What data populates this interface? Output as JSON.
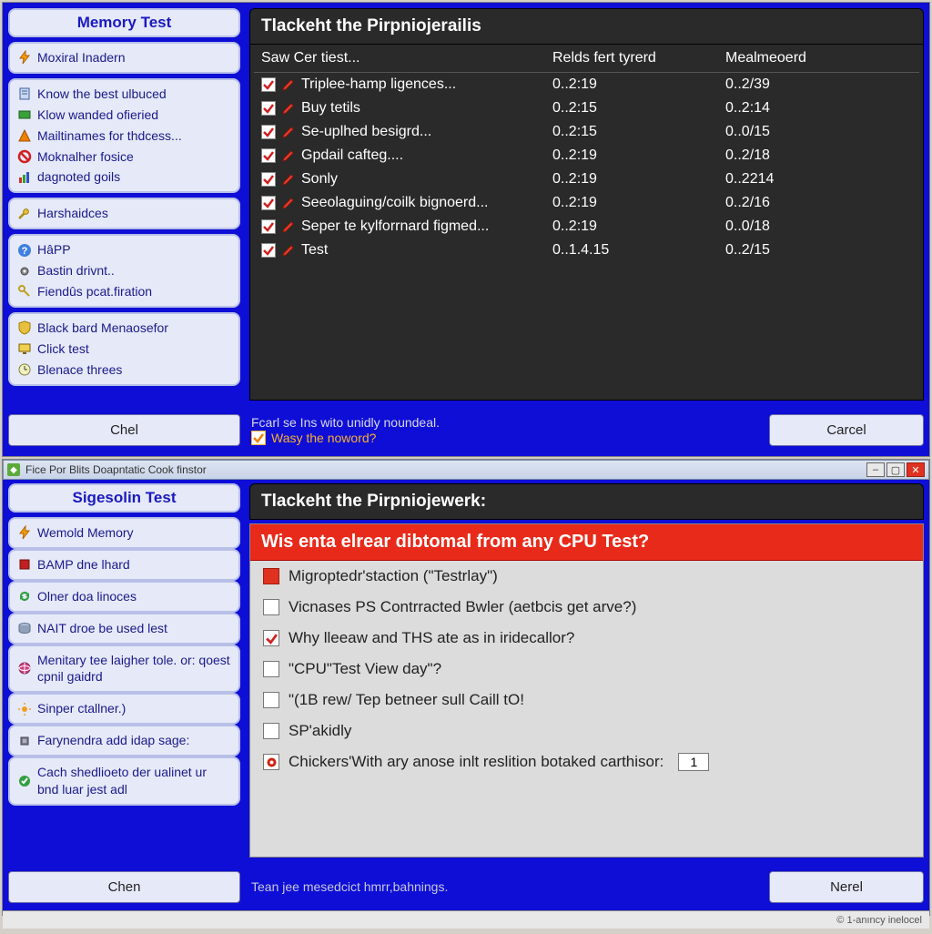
{
  "top": {
    "sidebar_title": "Memory Test",
    "group1": [
      {
        "icon": "bolt",
        "label": "Moxiral Inadern"
      }
    ],
    "group2": [
      {
        "icon": "doc",
        "label": "Know the best ulbuced"
      },
      {
        "icon": "green",
        "label": "Klow wanded ofieried"
      },
      {
        "icon": "orange",
        "label": "Mailtinames for thdcess..."
      },
      {
        "icon": "ored",
        "label": "Moknalher fosice"
      },
      {
        "icon": "chart",
        "label": "dagnoted goils"
      }
    ],
    "group3": [
      {
        "icon": "wrench",
        "label": "Harshaidces"
      }
    ],
    "group4": [
      {
        "icon": "help",
        "label": "HâPP"
      },
      {
        "icon": "gear",
        "label": "Bastin drivnt.."
      },
      {
        "icon": "key",
        "label": "Fiendûs pcat.firation"
      }
    ],
    "group5": [
      {
        "icon": "shield",
        "label": "Black bard Menaosefor"
      },
      {
        "icon": "monitor",
        "label": "Click test"
      },
      {
        "icon": "clock",
        "label": "Blenace threes"
      }
    ],
    "main_title": "Tlackeht the Pirpniojerailis",
    "cols": [
      "Saw Cer tiest...",
      "Relds fert tyrerd",
      "Mealmeoerd"
    ],
    "rows": [
      {
        "name": "Triplee-hamp ligences...",
        "a": "0..2:19",
        "b": "0..2/39"
      },
      {
        "name": "Buy tetils",
        "a": "0..2:15",
        "b": "0..2:14"
      },
      {
        "name": "Se-uplhed besigrd...",
        "a": "0..2:15",
        "b": "0..0/15"
      },
      {
        "name": "Gpdail cafteg....",
        "a": "0..2:19",
        "b": "0..2/18"
      },
      {
        "name": "Sonly",
        "a": "0..2:19",
        "b": "0..2214"
      },
      {
        "name": "Seeolaguing/coilk bignoerd...",
        "a": "0..2:19",
        "b": "0..2/16"
      },
      {
        "name": "Seper te kylforrnard figmed...",
        "a": "0..2:19",
        "b": "0..0/18"
      },
      {
        "name": "Test",
        "a": "0..1.4.15",
        "b": "0..2/15"
      }
    ],
    "footer_msg": "Fcarl se Ins wito unidly noundeal.",
    "footer_chk": "Wasy the noword?",
    "btn_left": "Chel",
    "btn_right": "Carcel"
  },
  "bot": {
    "titlebar": "Fice Por Blits Doapntatic Cook finstor",
    "sidebar_title": "Sigesolin Test",
    "items": [
      {
        "icon": "bolt",
        "label": "Wemold Memory"
      },
      {
        "icon": "stop",
        "label": "BAMP dne lhard"
      },
      {
        "icon": "refresh",
        "label": "Olner doa linoces"
      },
      {
        "icon": "disk",
        "label": "NAIT droe be used lest"
      },
      {
        "icon": "globe",
        "label": "Menitary tee laigher tole. or: qoest cpnil gaidrd"
      },
      {
        "icon": "sun",
        "label": "Sinper ctallner.)"
      },
      {
        "icon": "chip",
        "label": "Farynendra add idap sage:"
      },
      {
        "icon": "check",
        "label": "Cach shedlioeto der ualinet ur bnd luar jest adl"
      }
    ],
    "main_title": "Tlackeht the Pirpniojewerk:",
    "alert": "Wis enta elrear dibtomal from any CPU Test?",
    "opts": [
      {
        "state": "red",
        "text": "Migroptedr'staction (\"Testrlay\")"
      },
      {
        "state": "",
        "text": "Vicnases PS Contrracted Bwler (aetbcis get arve?)"
      },
      {
        "state": "checked",
        "text": "Why lleeaw and THS ate as in iridecallor?"
      },
      {
        "state": "",
        "text": "\"CPU\"Test View day\"?"
      },
      {
        "state": "",
        "text": "\"(1B rew/ Tep betneer sull Caill tO!"
      },
      {
        "state": "",
        "text": "SP'akidly"
      }
    ],
    "opt_last_prefix": "Chickers'With ary anose inlt reslition botaked carthisor:",
    "opt_last_value": "1",
    "footer_msg": "Tean jee mesedcict hmrr,bahnings.",
    "btn_left": "Chen",
    "btn_right": "Nerel",
    "status": "© 1-anıncy inelocel"
  }
}
